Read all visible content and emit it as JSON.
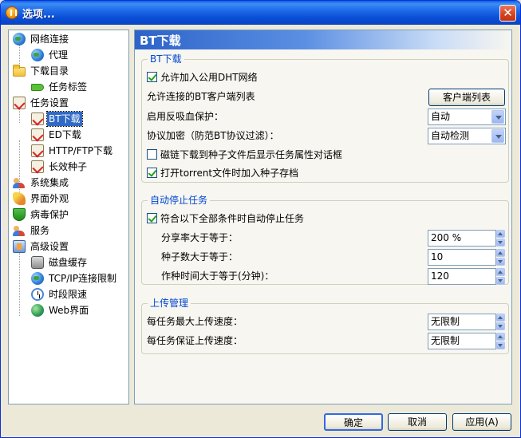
{
  "window": {
    "title": "选项..."
  },
  "tree": {
    "items": [
      {
        "label": "网络连接"
      },
      {
        "label": "代理"
      },
      {
        "label": "下载目录"
      },
      {
        "label": "任务标签"
      },
      {
        "label": "任务设置"
      },
      {
        "label": "BT下载"
      },
      {
        "label": "ED下载"
      },
      {
        "label": "HTTP/FTP下载"
      },
      {
        "label": "长效种子"
      },
      {
        "label": "系统集成"
      },
      {
        "label": "界面外观"
      },
      {
        "label": "病毒保护"
      },
      {
        "label": "服务"
      },
      {
        "label": "高级设置"
      },
      {
        "label": "磁盘缓存"
      },
      {
        "label": "TCP/IP连接限制"
      },
      {
        "label": "时段限速"
      },
      {
        "label": "Web界面"
      }
    ],
    "selected": "BT下载"
  },
  "panel": {
    "title": "BT下载"
  },
  "bt_group": {
    "title": "BT下载",
    "dht_label": "允许加入公用DHT网络",
    "dht_checked": true,
    "client_list_label": "允许连接的BT客户端列表",
    "client_list_button": "客户端列表",
    "anti_leech_label": "启用反吸血保护：",
    "anti_leech_value": "自动",
    "encryption_label": "协议加密（防范BT协议过滤）：",
    "encryption_value": "自动检测",
    "magnet_label": "磁链下载到种子文件后显示任务属性对话框",
    "magnet_checked": false,
    "torrent_archive_label": "打开torrent文件时加入种子存档",
    "torrent_archive_checked": true
  },
  "auto_stop_group": {
    "title": "自动停止任务",
    "enable_label": "符合以下全部条件时自动停止任务",
    "enable_checked": true,
    "share_ratio_label": "分享率大于等于：",
    "share_ratio_value": "200 %",
    "seeds_label": "种子数大于等于：",
    "seeds_value": "10",
    "seed_time_label": "作种时间大于等于(分钟)：",
    "seed_time_value": "120"
  },
  "upload_group": {
    "title": "上传管理",
    "max_upload_label": "每任务最大上传速度：",
    "max_upload_value": "无限制",
    "guaranteed_upload_label": "每任务保证上传速度：",
    "guaranteed_upload_value": "无限制"
  },
  "footer": {
    "ok_label": "确定",
    "cancel_label": "取消",
    "apply_label": "应用(A)"
  }
}
